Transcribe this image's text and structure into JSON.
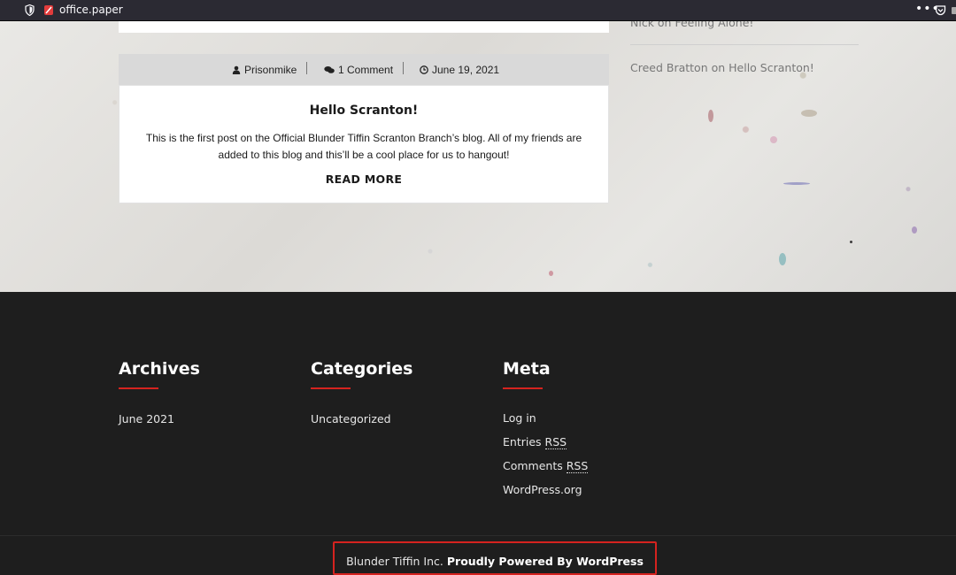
{
  "browser": {
    "url": "office.paper",
    "menu_glyph": "•••"
  },
  "post": {
    "author": "Prisonmike",
    "comments": "1 Comment",
    "date": "June 19, 2021",
    "title": "Hello Scranton!",
    "excerpt": "This is the first post on the Official Blunder Tiffin Scranton Branch’s blog. All of my friends are added to this blog and this’ll be a cool place for us to hangout!",
    "read_more": "READ MORE"
  },
  "sidebar": {
    "recent_comments": [
      "Nick on Feeling Alone!",
      "Creed Bratton on Hello Scranton!"
    ]
  },
  "footer": {
    "archives": {
      "title": "Archives",
      "items": [
        "June 2021"
      ]
    },
    "categories": {
      "title": "Categories",
      "items": [
        "Uncategorized"
      ]
    },
    "meta": {
      "title": "Meta",
      "log_in": "Log in",
      "entries_prefix": "Entries ",
      "comments_prefix": "Comments ",
      "rss": "RSS",
      "wordpress": "WordPress.org"
    },
    "credit_company": "Blunder Tiffin Inc.",
    "credit_powered": "Proudly Powered By WordPress"
  },
  "colors": {
    "accent": "#d5231f",
    "footer_bg": "#1e1e1e",
    "browser_bar": "#2b2a33"
  }
}
